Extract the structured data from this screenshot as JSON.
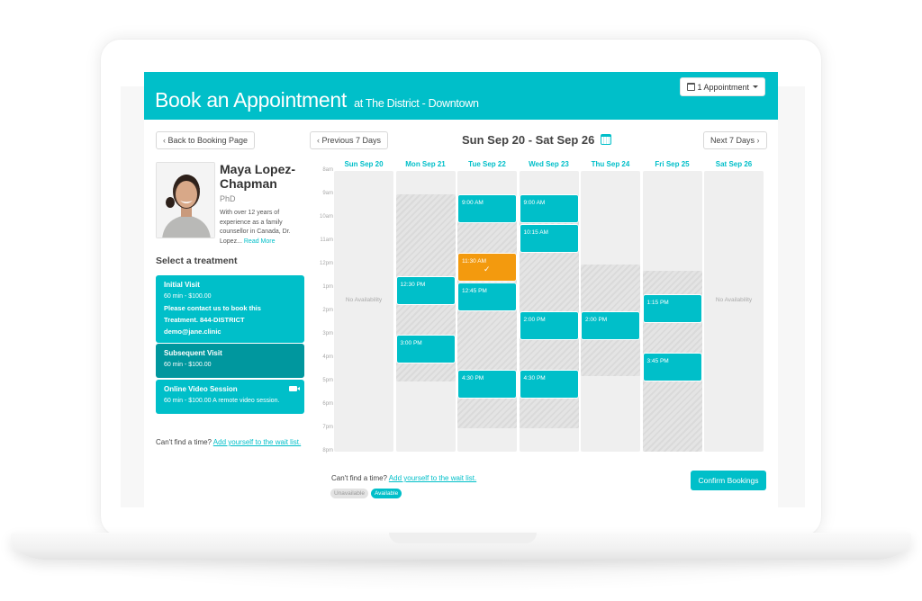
{
  "header": {
    "title": "Book an Appointment",
    "location": "at The District - Downtown",
    "appointments_button": "1 Appointment"
  },
  "nav": {
    "back_label": "Back to Booking Page",
    "prev_label": "Previous 7 Days",
    "next_label": "Next 7 Days",
    "date_range": "Sun Sep 20 - Sat Sep 26"
  },
  "practitioner": {
    "name": "Maya Lopez-Chapman",
    "credential": "PhD",
    "bio": "With over 12 years of experience as a family counsellor in Canada, Dr. Lopez...",
    "read_more": "Read More"
  },
  "treatments": {
    "title": "Select a treatment",
    "items": [
      {
        "name": "Initial Visit",
        "meta": "60 min - $100.00",
        "note_1": "Please contact us to book this",
        "note_2": "Treatment. 844-DISTRICT",
        "note_3": "demo@jane.clinic",
        "selected": false
      },
      {
        "name": "Subsequent Visit",
        "meta": "60 min - $100.00",
        "selected": true
      },
      {
        "name": "Online Video Session",
        "meta": "60 min - $100.00 A remote video session.",
        "icon": "video-camera-icon",
        "selected": false
      }
    ]
  },
  "waitlist": {
    "prompt": "Can't find a time?",
    "link_left": "Add yourself to the wait list.",
    "link_bottom": "Add yourself to the wait list."
  },
  "calendar": {
    "hours": [
      "8am",
      "9am",
      "10am",
      "11am",
      "12pm",
      "1pm",
      "2pm",
      "3pm",
      "4pm",
      "5pm",
      "6pm",
      "7pm",
      "8pm"
    ],
    "days": [
      {
        "label": "Sun Sep 20",
        "no_availability": "No Availability",
        "unavailable": [],
        "slots": []
      },
      {
        "label": "Mon Sep 21",
        "unavailable": [
          [
            9,
            17
          ]
        ],
        "slots": [
          {
            "time": "12:30 PM",
            "start": 12.5
          },
          {
            "time": "3:00 PM",
            "start": 15
          }
        ]
      },
      {
        "label": "Tue Sep 22",
        "unavailable": [
          [
            9,
            19
          ]
        ],
        "slots": [
          {
            "time": "9:00 AM",
            "start": 9
          },
          {
            "time": "11:30 AM",
            "start": 11.5,
            "selected": true
          },
          {
            "time": "12:45 PM",
            "start": 12.75
          },
          {
            "time": "4:30 PM",
            "start": 16.5
          }
        ]
      },
      {
        "label": "Wed Sep 23",
        "unavailable": [
          [
            9,
            19
          ]
        ],
        "slots": [
          {
            "time": "9:00 AM",
            "start": 9
          },
          {
            "time": "10:15 AM",
            "start": 10.25
          },
          {
            "time": "2:00 PM",
            "start": 14
          },
          {
            "time": "4:30 PM",
            "start": 16.5
          }
        ]
      },
      {
        "label": "Thu Sep 24",
        "unavailable": [
          [
            12,
            16.75
          ]
        ],
        "slots": [
          {
            "time": "2:00 PM",
            "start": 14
          }
        ]
      },
      {
        "label": "Fri Sep 25",
        "unavailable": [
          [
            12.25,
            20
          ]
        ],
        "slots": [
          {
            "time": "1:15 PM",
            "start": 13.25
          },
          {
            "time": "3:45 PM",
            "start": 15.75
          }
        ]
      },
      {
        "label": "Sat Sep 26",
        "no_availability": "No Availability",
        "unavailable": [],
        "slots": []
      }
    ]
  },
  "legend": {
    "unavailable": "Unavailable",
    "available": "Available"
  },
  "confirm_label": "Confirm Bookings",
  "colors": {
    "brand": "#00bfc9",
    "selected_treatment": "#00979e",
    "selected_slot": "#f39a0e"
  }
}
